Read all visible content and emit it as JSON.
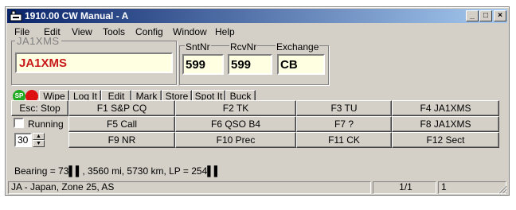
{
  "window": {
    "title": "1910.00 CW Manual - A",
    "minimize_glyph": "_",
    "maximize_glyph": "□",
    "close_glyph": "×"
  },
  "menu": {
    "file": "File",
    "edit": "Edit",
    "view": "View",
    "tools": "Tools",
    "config": "Config",
    "window": "Window",
    "help": "Help"
  },
  "entry": {
    "callsign_label": "JA1XMS",
    "callsign_value": "JA1XMS",
    "sntnr_label": "SntNr",
    "sntnr_value": "599",
    "rcvnr_label": "RcvNr",
    "rcvnr_value": "599",
    "exchange_label": "Exchange",
    "exchange_value": "CB"
  },
  "toolbar": {
    "sp_led_label": "SP",
    "wipe": "Wipe",
    "log_it": "Log It",
    "edit": "Edit",
    "mark": "Mark",
    "store": "Store",
    "spot_it": "Spot It",
    "bust": "Buck"
  },
  "controls": {
    "esc_stop": "Esc: Stop",
    "running": "Running",
    "speed_value": "30",
    "spin_up": "▲",
    "spin_down": "▼"
  },
  "fkeys": {
    "f1": "F1 S&P CQ",
    "f2": "F2 TK",
    "f3": "F3 TU",
    "f4": "F4 JA1XMS",
    "f5": "F5 Call",
    "f6": "F6 QSO B4",
    "f7": "F7 ?",
    "f8": "F8 JA1XMS",
    "f9": "F9 NR",
    "f10": "F10 Prec",
    "f11": "F11 CK",
    "f12": "F12 Sect"
  },
  "info": {
    "bearing": "Bearing = 73▌▌, 3560  mi, 5730 km, LP = 254▌▌"
  },
  "status": {
    "country": "JA - Japan, Zone 25, AS",
    "pages": "1/1",
    "count": "1"
  },
  "colors": {
    "titlebar_start": "#0a246a",
    "titlebar_end": "#a6caf0",
    "face": "#d4d0c8",
    "field_bg": "#ffffe1",
    "callsign_text": "#c81a1a",
    "led_green": "#22aa22",
    "led_red": "#dd1111"
  }
}
